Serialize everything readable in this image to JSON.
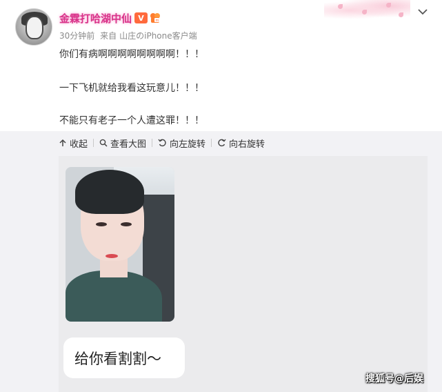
{
  "post": {
    "username": "金霖打哈湖中仙",
    "vip_badge": "V",
    "time": "30分钟前",
    "source_prefix": "来自",
    "source_client": "山庄のiPhone客户端",
    "lines": [
      "你们有病啊啊啊啊啊啊啊啊！！！",
      "一下飞机就给我看这玩意儿！！！",
      "不能只有老子一个人遭这罪！！！"
    ]
  },
  "toolbar": {
    "collapse_label": "收起",
    "view_large_label": "查看大图",
    "rotate_left_label": "向左旋转",
    "rotate_right_label": "向右旋转"
  },
  "media": {
    "caption": "给你看割割～"
  },
  "watermark": {
    "text": "搜狐号@后娱"
  },
  "icons": {
    "header": [
      "avatar",
      "vip-icon",
      "member-icon",
      "chevron-down-icon"
    ],
    "toolbar": [
      "collapse-icon",
      "search-icon",
      "rotate-left-icon",
      "rotate-right-icon"
    ]
  },
  "colors": {
    "username": "#d9338a",
    "vip_badge": "#ff6a3d",
    "meta": "#8a8a8a",
    "background_gray": "#f2f2f5"
  }
}
